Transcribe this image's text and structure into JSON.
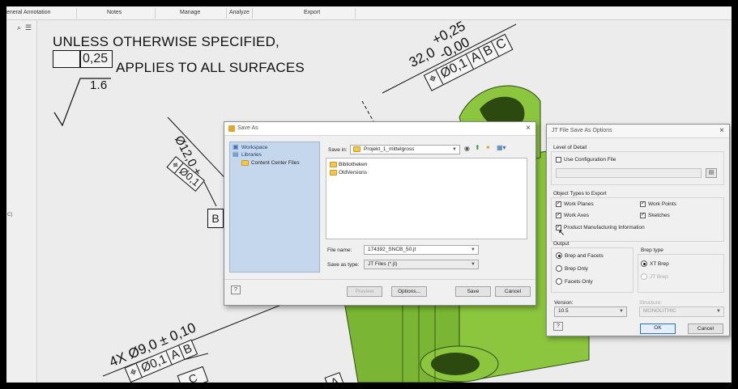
{
  "ribbon": {
    "tabs": [
      "eneral Annotation",
      "Notes",
      "Manage",
      "Analyze",
      "Export"
    ]
  },
  "side_label": "C)",
  "drawing": {
    "note_line1": "UNLESS OTHERWISE SPECIFIED,",
    "profile_tolerance": "0,25",
    "note_line2": "APPLIES TO ALL SURFACES",
    "roughness": "1.6",
    "dim_top": "32,0",
    "dim_top_upper_tol": "+0,25",
    "dim_top_lower_tol": "-0,00",
    "fcf_top": {
      "symbol": "⌖",
      "tol": "Ø0,1",
      "datum1": "A",
      "datum2": "B",
      "datum3": "C"
    },
    "dim_left": "Ø12,0 ±",
    "fcf_left": {
      "symbol": "⌖",
      "tol": "Ø0,1"
    },
    "datum_b": "B",
    "dim_bottom": "4X Ø9,0 ± 0,10",
    "fcf_bottom": {
      "symbol": "⌖",
      "tol": "Ø0,1",
      "datum1": "A",
      "datum2": "B"
    },
    "datum_c": "C",
    "datum_a": "A",
    "colors": {
      "part_green": "#8cc63f",
      "part_green_dark": "#5f9a22",
      "hole": "#2c4a10"
    }
  },
  "save_as": {
    "title": "Save As",
    "close": "×",
    "tree": {
      "workspace": "Workspace",
      "libraries": "Libraries",
      "content_center": "Content Center Files"
    },
    "save_in_label": "Save in:",
    "save_in_value": "Projekt_1_mittelgross",
    "files": [
      "Bibliotheken",
      "OldVersions"
    ],
    "file_name_label": "File name:",
    "file_name_value": "174392_SNCB_50.jt",
    "save_as_type_label": "Save as type:",
    "save_as_type_value": "JT Files (*.jt)",
    "preview_button": "Preview",
    "options_button": "Options...",
    "save_button": "Save",
    "cancel_button": "Cancel"
  },
  "jt_options": {
    "title": "JT File Save As Options",
    "close": "×",
    "level_of_detail_label": "Level of Detail",
    "use_config_file": {
      "label": "Use Configuration File",
      "checked": false
    },
    "object_types_label": "Object Types to Export",
    "work_planes": {
      "label": "Work Planes",
      "checked": true
    },
    "work_points": {
      "label": "Work Points",
      "checked": true
    },
    "work_axes": {
      "label": "Work Axes",
      "checked": true
    },
    "sketches": {
      "label": "Sketches",
      "checked": true
    },
    "pmi": {
      "label": "Product Manufacturing Information",
      "checked": true
    },
    "output_label": "Output",
    "brep_and_facets": "Brep and Facets",
    "brep_only": "Brep Only",
    "facets_only": "Facets Only",
    "output_selected": "Brep and Facets",
    "brep_type_label": "Brep type",
    "xt_brep": "XT Brep",
    "jt_brep": "JT Brep",
    "brep_type_selected": "XT Brep",
    "version_label": "Version:",
    "version_value": "10.5",
    "structure_label": "Structure:",
    "structure_value": "MONOLITHIC",
    "ok_button": "OK",
    "cancel_button": "Cancel"
  }
}
